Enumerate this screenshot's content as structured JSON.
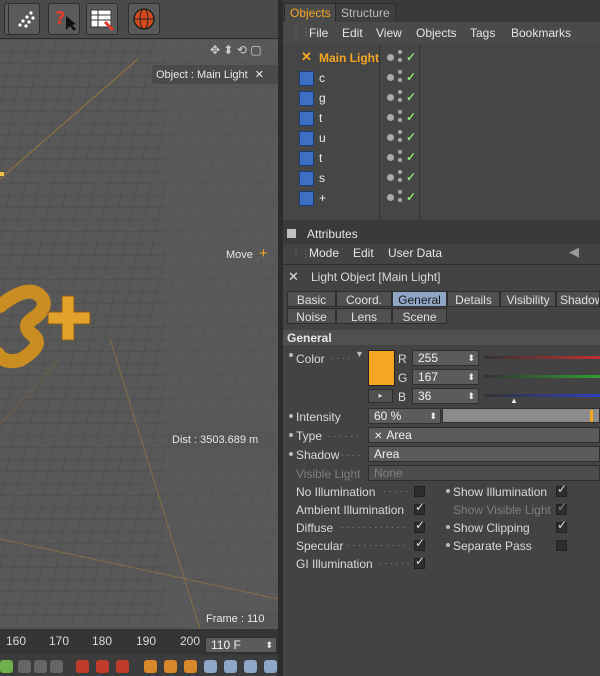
{
  "viewport": {
    "object_label": "Object : Main Light",
    "move_label": "Move",
    "dist_label": "Dist : 3503.689 m",
    "frame_label": "Frame : 110"
  },
  "timeline": {
    "ruler": [
      "160",
      "170",
      "180",
      "190",
      "200"
    ],
    "current_frame": "110 F"
  },
  "objects_panel": {
    "tabs": [
      "Objects",
      "Structure"
    ],
    "menu": [
      "File",
      "Edit",
      "View",
      "Objects",
      "Tags",
      "Bookmarks"
    ],
    "items": [
      {
        "name": "Main Light",
        "selected": true,
        "icon": "light-icon"
      },
      {
        "name": "c",
        "icon": "spline-icon"
      },
      {
        "name": "g",
        "icon": "spline-icon"
      },
      {
        "name": "t",
        "icon": "spline-icon"
      },
      {
        "name": "u",
        "icon": "spline-icon"
      },
      {
        "name": "t",
        "icon": "spline-icon"
      },
      {
        "name": "s",
        "icon": "spline-icon"
      },
      {
        "name": "+",
        "icon": "spline-icon"
      }
    ]
  },
  "attributes": {
    "title": "Attributes",
    "menu": [
      "Mode",
      "Edit",
      "User Data"
    ],
    "object_title": "Light Object [Main Light]",
    "tabs_row1": [
      "Basic",
      "Coord.",
      "General",
      "Details",
      "Visibility",
      "Shadow"
    ],
    "tabs_row2": [
      "Noise",
      "Lens",
      "Scene"
    ],
    "active_tab": "General",
    "section": "General",
    "color_label": "Color",
    "color": {
      "r": "255",
      "g": "167",
      "b": "36",
      "hex": "#f5a724"
    },
    "rgb_labels": [
      "R",
      "G",
      "B"
    ],
    "intensity_label": "Intensity",
    "intensity_value": "60 %",
    "intensity_fraction": 0.6,
    "type_label": "Type",
    "type_value": "Area",
    "shadow_label": "Shadow",
    "shadow_value": "Area",
    "visible_light_label": "Visible Light",
    "visible_light_value": "None",
    "left_options": [
      {
        "label": "No Illumination",
        "checked": false
      },
      {
        "label": "Ambient Illumination",
        "checked": true
      },
      {
        "label": "Diffuse",
        "checked": true
      },
      {
        "label": "Specular",
        "checked": true
      },
      {
        "label": "GI Illumination",
        "checked": true
      }
    ],
    "right_options": [
      {
        "label": "Show Illumination",
        "checked": true,
        "dim": false
      },
      {
        "label": "Show Visible Light",
        "checked": true,
        "dim": true
      },
      {
        "label": "Show Clipping",
        "checked": true,
        "dim": false
      },
      {
        "label": "Separate Pass",
        "checked": false,
        "dim": false
      }
    ]
  },
  "colors": {
    "accent": "#f5a724",
    "selected_name": "#f5a724"
  }
}
